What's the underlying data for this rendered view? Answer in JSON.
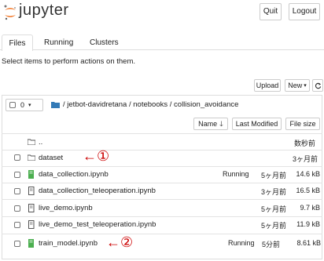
{
  "header": {
    "logo_text": "jupyter",
    "quit_label": "Quit",
    "logout_label": "Logout"
  },
  "tabs": [
    {
      "label": "Files",
      "active": true
    },
    {
      "label": "Running",
      "active": false
    },
    {
      "label": "Clusters",
      "active": false
    }
  ],
  "instruction": "Select items to perform actions on them.",
  "toolbar": {
    "upload_label": "Upload",
    "new_label": "New",
    "selected_count": "0",
    "breadcrumb": [
      "jetbot-davidretana",
      "notebooks",
      "collision_avoidance"
    ],
    "sort_name_label": "Name",
    "last_modified_label": "Last Modified",
    "file_size_label": "File size"
  },
  "files": [
    {
      "name": "..",
      "type": "folder",
      "status": "",
      "modified": "数秒前",
      "size": ""
    },
    {
      "name": "dataset",
      "type": "folder",
      "status": "",
      "modified": "3ヶ月前",
      "size": ""
    },
    {
      "name": "data_collection.ipynb",
      "type": "notebook-running",
      "status": "Running",
      "modified": "5ヶ月前",
      "size": "14.6 kB"
    },
    {
      "name": "data_collection_teleoperation.ipynb",
      "type": "notebook",
      "status": "",
      "modified": "3ヶ月前",
      "size": "16.5 kB"
    },
    {
      "name": "live_demo.ipynb",
      "type": "notebook",
      "status": "",
      "modified": "5ヶ月前",
      "size": "9.7 kB"
    },
    {
      "name": "live_demo_test_teleoperation.ipynb",
      "type": "notebook",
      "status": "",
      "modified": "5ヶ月前",
      "size": "11.9 kB"
    },
    {
      "name": "train_model.ipynb",
      "type": "notebook-running",
      "status": "Running",
      "modified": "5分前",
      "size": "8.61 kB"
    }
  ],
  "annotations": [
    {
      "arrow": "←",
      "marker": "①"
    },
    {
      "arrow": "←",
      "marker": "②"
    }
  ],
  "colors": {
    "running_notebook": "#4caf50",
    "folder": "#555555",
    "annotation": "#cc0000",
    "logo_orange": "#f37726"
  }
}
